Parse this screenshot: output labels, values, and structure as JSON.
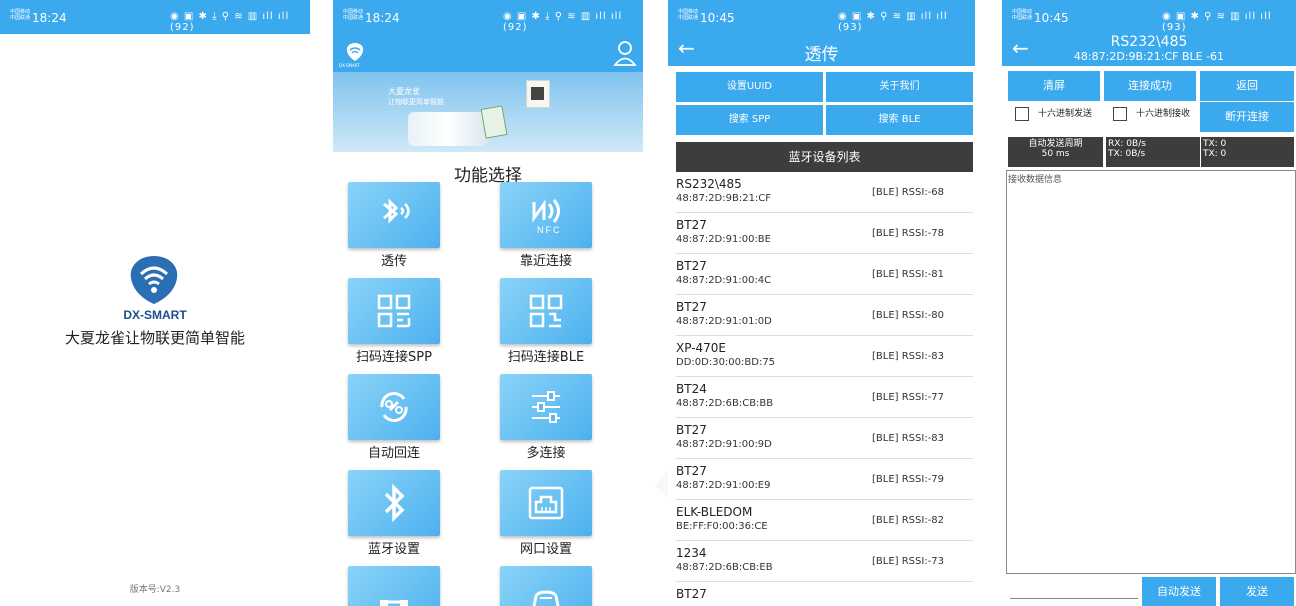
{
  "status": {
    "s1": {
      "carrier": "中国移动 中国联通",
      "time": "18:24",
      "icons": "◉ ▣ ✱ ⤓   ⚲ ≋ ▥ ıll ıll (92)"
    },
    "s2": {
      "carrier": "中国移动 中国联通",
      "time": "18:24",
      "icons": "◉ ▣ ✱ ⤓   ⚲ ≋ ▥ ıll ıll (92)"
    },
    "s3": {
      "carrier": "中国移动 中国联通",
      "time": "10:45",
      "icons": "◉ ▣ ✱   ⚲ ≋ ▥ ıll ıll (93)"
    },
    "s4": {
      "carrier": "中国移动 中国联通",
      "time": "10:45",
      "icons": "◉ ▣ ✱   ⚲ ≋ ▥ ıll ıll (93)"
    }
  },
  "splash": {
    "brand": "DX-SMART",
    "slogan": "大夏龙雀让物联更简单智能",
    "version": "版本号:V2.3"
  },
  "menu": {
    "logo_text": "DX-SMART",
    "banner_line1": "大夏龙雀",
    "banner_line2": "让物联更简单智能",
    "title": "功能选择",
    "items": [
      {
        "label": "透传",
        "icon": "bluetooth-wave-icon"
      },
      {
        "label": "靠近连接",
        "icon": "nfc-icon"
      },
      {
        "label": "扫码连接SPP",
        "icon": "qr-code-icon"
      },
      {
        "label": "扫码连接BLE",
        "icon": "qr-code-icon"
      },
      {
        "label": "自动回连",
        "icon": "link-refresh-icon"
      },
      {
        "label": "多连接",
        "icon": "sliders-icon"
      },
      {
        "label": "蓝牙设置",
        "icon": "bluetooth-icon"
      },
      {
        "label": "网口设置",
        "icon": "ethernet-port-icon"
      }
    ]
  },
  "scan": {
    "title": "透传",
    "buttons": {
      "set_uuid": "设置UUID",
      "about": "关于我们",
      "search_spp": "搜索 SPP",
      "search_ble": "搜索 BLE"
    },
    "list_header": "蓝牙设备列表",
    "devices": [
      {
        "name": "RS232\\485",
        "addr": "48:87:2D:9B:21:CF",
        "rssi": "[BLE]  RSSI:-68"
      },
      {
        "name": "BT27",
        "addr": "48:87:2D:91:00:BE",
        "rssi": "[BLE]  RSSI:-78"
      },
      {
        "name": "BT27",
        "addr": "48:87:2D:91:00:4C",
        "rssi": "[BLE]  RSSI:-81"
      },
      {
        "name": "BT27",
        "addr": "48:87:2D:91:01:0D",
        "rssi": "[BLE]  RSSI:-80"
      },
      {
        "name": "XP-470E",
        "addr": "DD:0D:30:00:BD:75",
        "rssi": "[BLE]  RSSI:-83"
      },
      {
        "name": "BT24",
        "addr": "48:87:2D:6B:CB:BB",
        "rssi": "[BLE]  RSSI:-77"
      },
      {
        "name": "BT27",
        "addr": "48:87:2D:91:00:9D",
        "rssi": "[BLE]  RSSI:-83"
      },
      {
        "name": "BT27",
        "addr": "48:87:2D:91:00:E9",
        "rssi": "[BLE]  RSSI:-79"
      },
      {
        "name": "ELK-BLEDOM",
        "addr": "BE:FF:F0:00:36:CE",
        "rssi": "[BLE]  RSSI:-82"
      },
      {
        "name": "1234",
        "addr": "48:87:2D:6B:CB:EB",
        "rssi": "[BLE]  RSSI:-73"
      },
      {
        "name": "BT27",
        "addr": "",
        "rssi": ""
      }
    ]
  },
  "terminal": {
    "title": "RS232\\485",
    "subtitle": "48:87:2D:9B:21:CF   BLE -61",
    "buttons": {
      "clear": "清屏",
      "connected": "连接成功",
      "back": "返回",
      "disconnect": "断开连接",
      "auto_send": "自动发送",
      "send": "发送"
    },
    "hex_send": "十六进制发送",
    "hex_recv": "十六进制接收",
    "period_label": "自动发送周期",
    "period_value": "50 ms",
    "rx_rate": "RX: 0B/s",
    "tx_rate": "TX: 0B/s",
    "tx_count": "TX: 0",
    "tx_count2": "TX: 0",
    "recv_placeholder": "接收数据信息"
  },
  "colors": {
    "primary": "#3aa9ee",
    "dark_bar": "#3d3d3d"
  }
}
